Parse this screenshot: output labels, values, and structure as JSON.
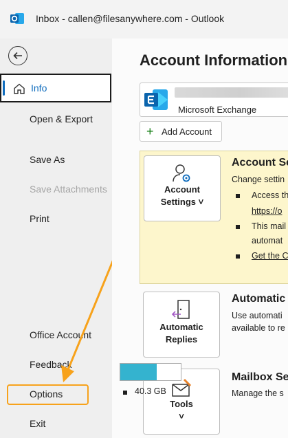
{
  "window": {
    "title": "Inbox - callen@filesanywhere.com  -  Outlook"
  },
  "sidebar": {
    "items": [
      {
        "label": "Info"
      },
      {
        "label": "Open & Export"
      },
      {
        "label": "Save As"
      },
      {
        "label": "Save Attachments"
      },
      {
        "label": "Print"
      },
      {
        "label": "Office Account"
      },
      {
        "label": "Feedback"
      },
      {
        "label": "Options"
      },
      {
        "label": "Exit"
      }
    ]
  },
  "main": {
    "title": "Account Information",
    "account": {
      "type": "Microsoft Exchange"
    },
    "add_account": "Add Account",
    "account_settings": {
      "tile_line1": "Account",
      "tile_line2": "Settings ˅",
      "heading": "Account Se",
      "desc": "Change settin",
      "bullets": [
        "Access th",
        "https://o",
        "This mail",
        "automat",
        "Get the C"
      ]
    },
    "automatic_replies": {
      "tile_line1": "Automatic",
      "tile_line2": "Replies",
      "heading": "Automatic",
      "desc1": "Use automati",
      "desc2": "available to re"
    },
    "mailbox": {
      "tile_label": "Tools",
      "tile_chevron": "˅",
      "heading": "Mailbox Se",
      "desc": "Manage the s",
      "storage": "40.3 GB",
      "usage_fraction": 0.6
    }
  },
  "colors": {
    "accent": "#0f6cbd",
    "highlight": "#f7a21b",
    "tip_bg": "#fdf6cc"
  }
}
